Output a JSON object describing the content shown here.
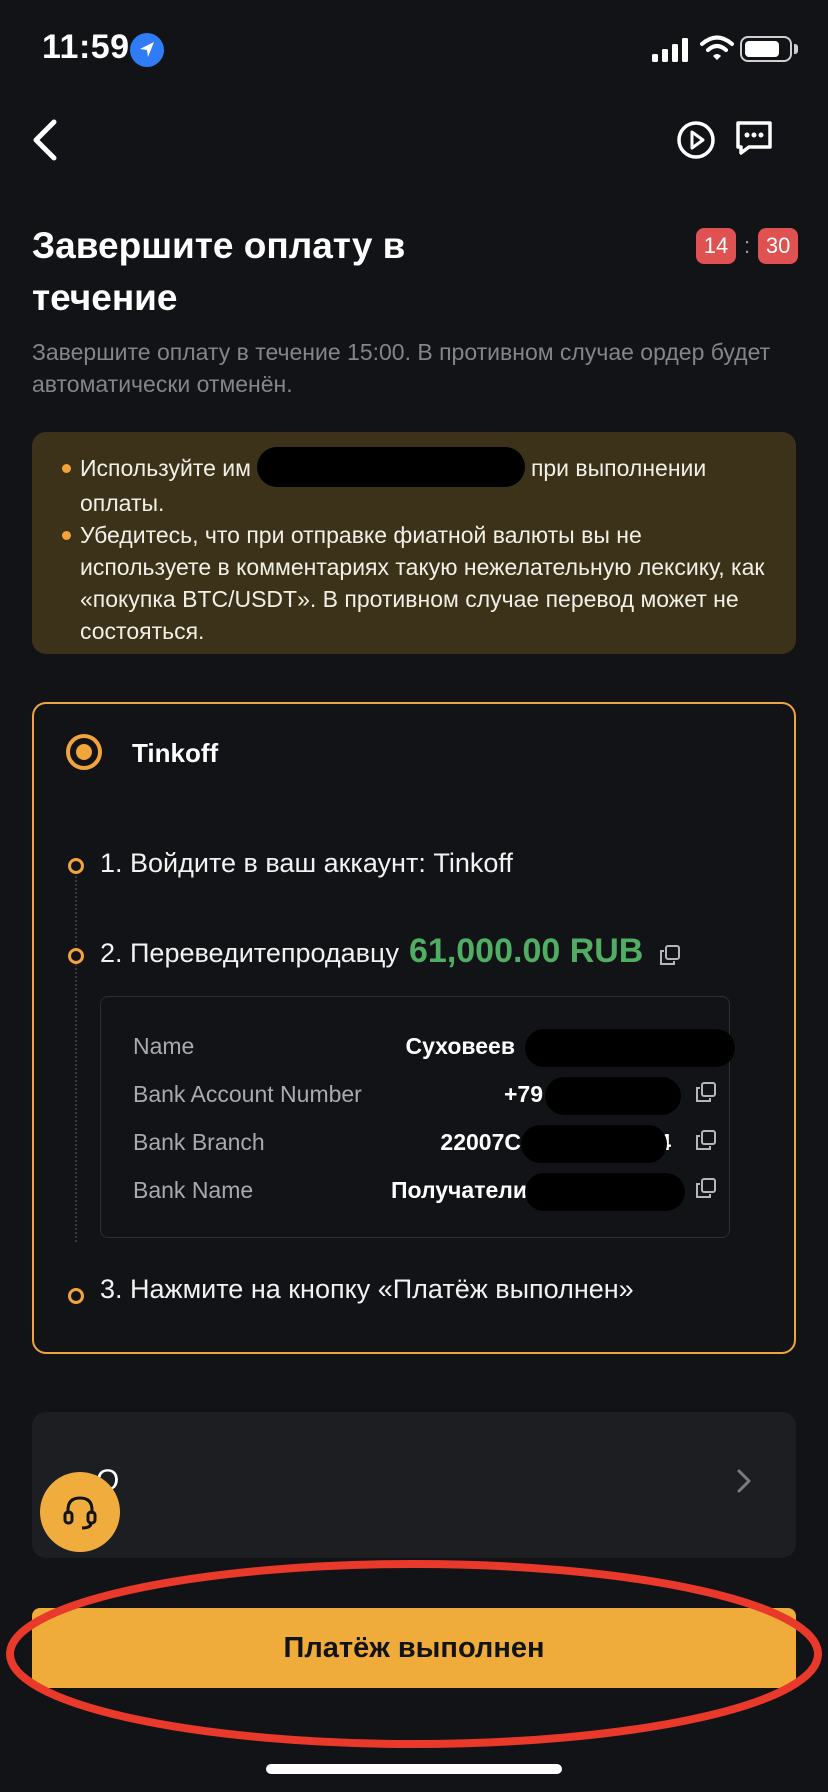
{
  "status_bar": {
    "time": "11:59"
  },
  "header": {
    "title": "Завершите оплату в течение",
    "timer_minutes": "14",
    "timer_separator": ":",
    "timer_seconds": "30",
    "subtitle": "Завершите оплату в течение 15:00. В противном случае ордер будет автоматически отменён."
  },
  "notice": {
    "item1_before": "Используйте им",
    "item1_after": "при выполнении оплаты.",
    "item2": "Убедитесь, что при отправке фиатной валюты вы не используете в комментариях такую нежелательную лексику, как «покупка BTC/USDT». В противном случае перевод может не состояться.",
    "accent_color": "#f0a43a"
  },
  "payment": {
    "method": "Tinkoff",
    "step1": "1. Войдите в ваш аккаунт:  Tinkoff",
    "step2": "2. Переведитепродавцу",
    "amount": "61,000.00 RUB",
    "step3": "3. Нажмите на кнопку «Платёж выполнен»",
    "details": [
      {
        "label": "Name",
        "value": "Суховеев"
      },
      {
        "label": "Bank Account Number",
        "value": "+79"
      },
      {
        "label": "Bank Branch",
        "value": "22007С"
      },
      {
        "label": "Bank Name",
        "value": "Получатели"
      }
    ],
    "bank_branch_tail": "4"
  },
  "bottom_row": {
    "text": "О"
  },
  "primary_button": {
    "label": "Платёж выполнен"
  },
  "colors": {
    "amount": "#4fae62",
    "button": "#efac3a",
    "timer": "#e05252",
    "annotation": "#e8392a"
  }
}
